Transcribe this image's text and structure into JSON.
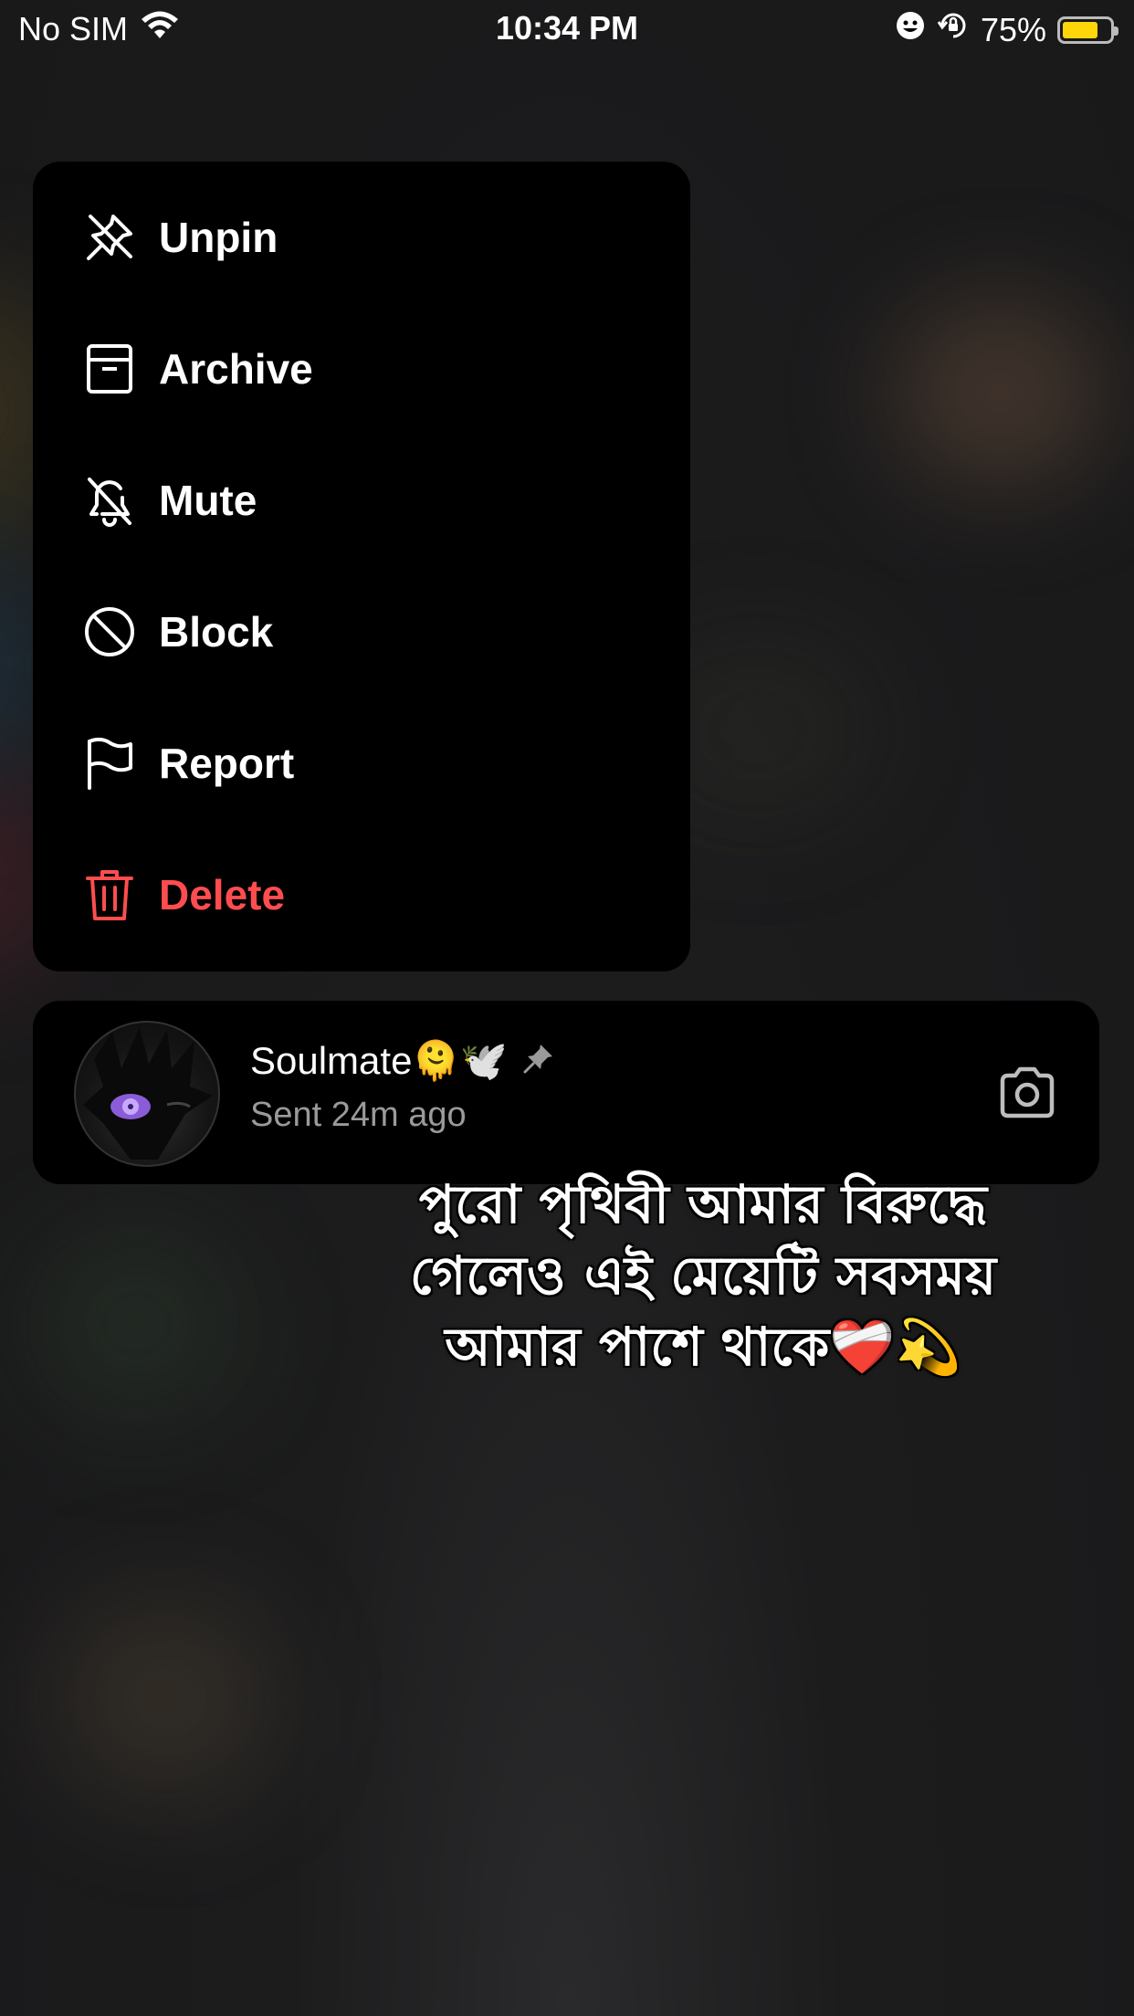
{
  "status_bar": {
    "carrier": "No SIM",
    "time": "10:34 PM",
    "battery_percent": "75%",
    "battery_level": 0.75,
    "battery_color": "#ffd60a"
  },
  "menu": {
    "items": [
      {
        "label": "Unpin",
        "icon": "unpin-icon"
      },
      {
        "label": "Archive",
        "icon": "archive-icon"
      },
      {
        "label": "Mute",
        "icon": "mute-icon"
      },
      {
        "label": "Block",
        "icon": "block-icon"
      },
      {
        "label": "Report",
        "icon": "flag-icon"
      },
      {
        "label": "Delete",
        "icon": "trash-icon",
        "color": "#ff4d4f"
      }
    ]
  },
  "chat": {
    "name": "Soulmate🫠🕊️",
    "status": "Sent 24m ago",
    "pinned": true
  },
  "overlay_text": "পুরো পৃথিবী আমার বিরুদ্ধে গেলেও এই মেয়েটি সবসময় আমার পাশে থাকে❤️‍🩹💫"
}
